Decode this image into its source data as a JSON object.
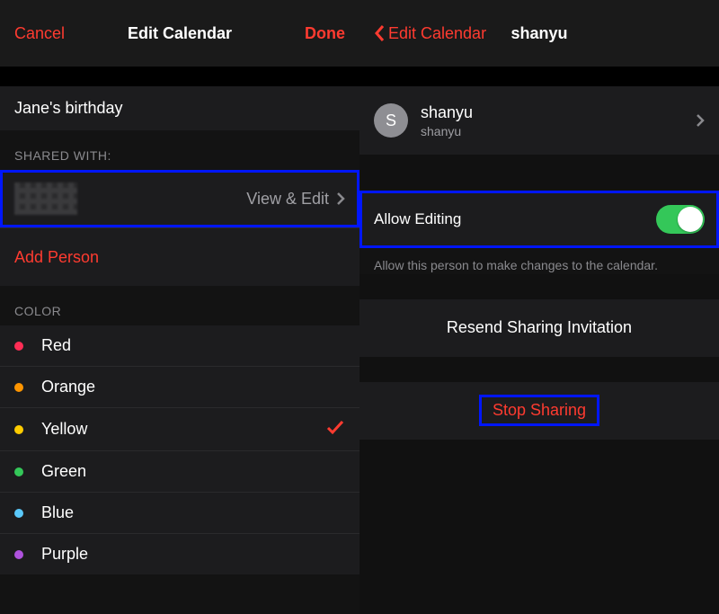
{
  "left": {
    "nav": {
      "cancel": "Cancel",
      "title": "Edit Calendar",
      "done": "Done"
    },
    "calendar_name": "Jane's birthday",
    "shared_with_header": "SHARED WITH:",
    "shared_entry_accessory": "View & Edit",
    "add_person": "Add Person",
    "color_header": "COLOR",
    "colors": {
      "red": "Red",
      "orange": "Orange",
      "yellow": "Yellow",
      "green": "Green",
      "blue": "Blue",
      "purple": "Purple"
    },
    "selected_color": "yellow"
  },
  "right": {
    "nav": {
      "back": "Edit Calendar",
      "title": "shanyu"
    },
    "person": {
      "avatar_initial": "S",
      "name": "shanyu",
      "sub": "shanyu"
    },
    "allow_editing_label": "Allow Editing",
    "allow_editing_on": true,
    "allow_editing_note": "Allow this person to make changes to the calendar.",
    "resend": "Resend Sharing Invitation",
    "stop_sharing": "Stop Sharing"
  }
}
